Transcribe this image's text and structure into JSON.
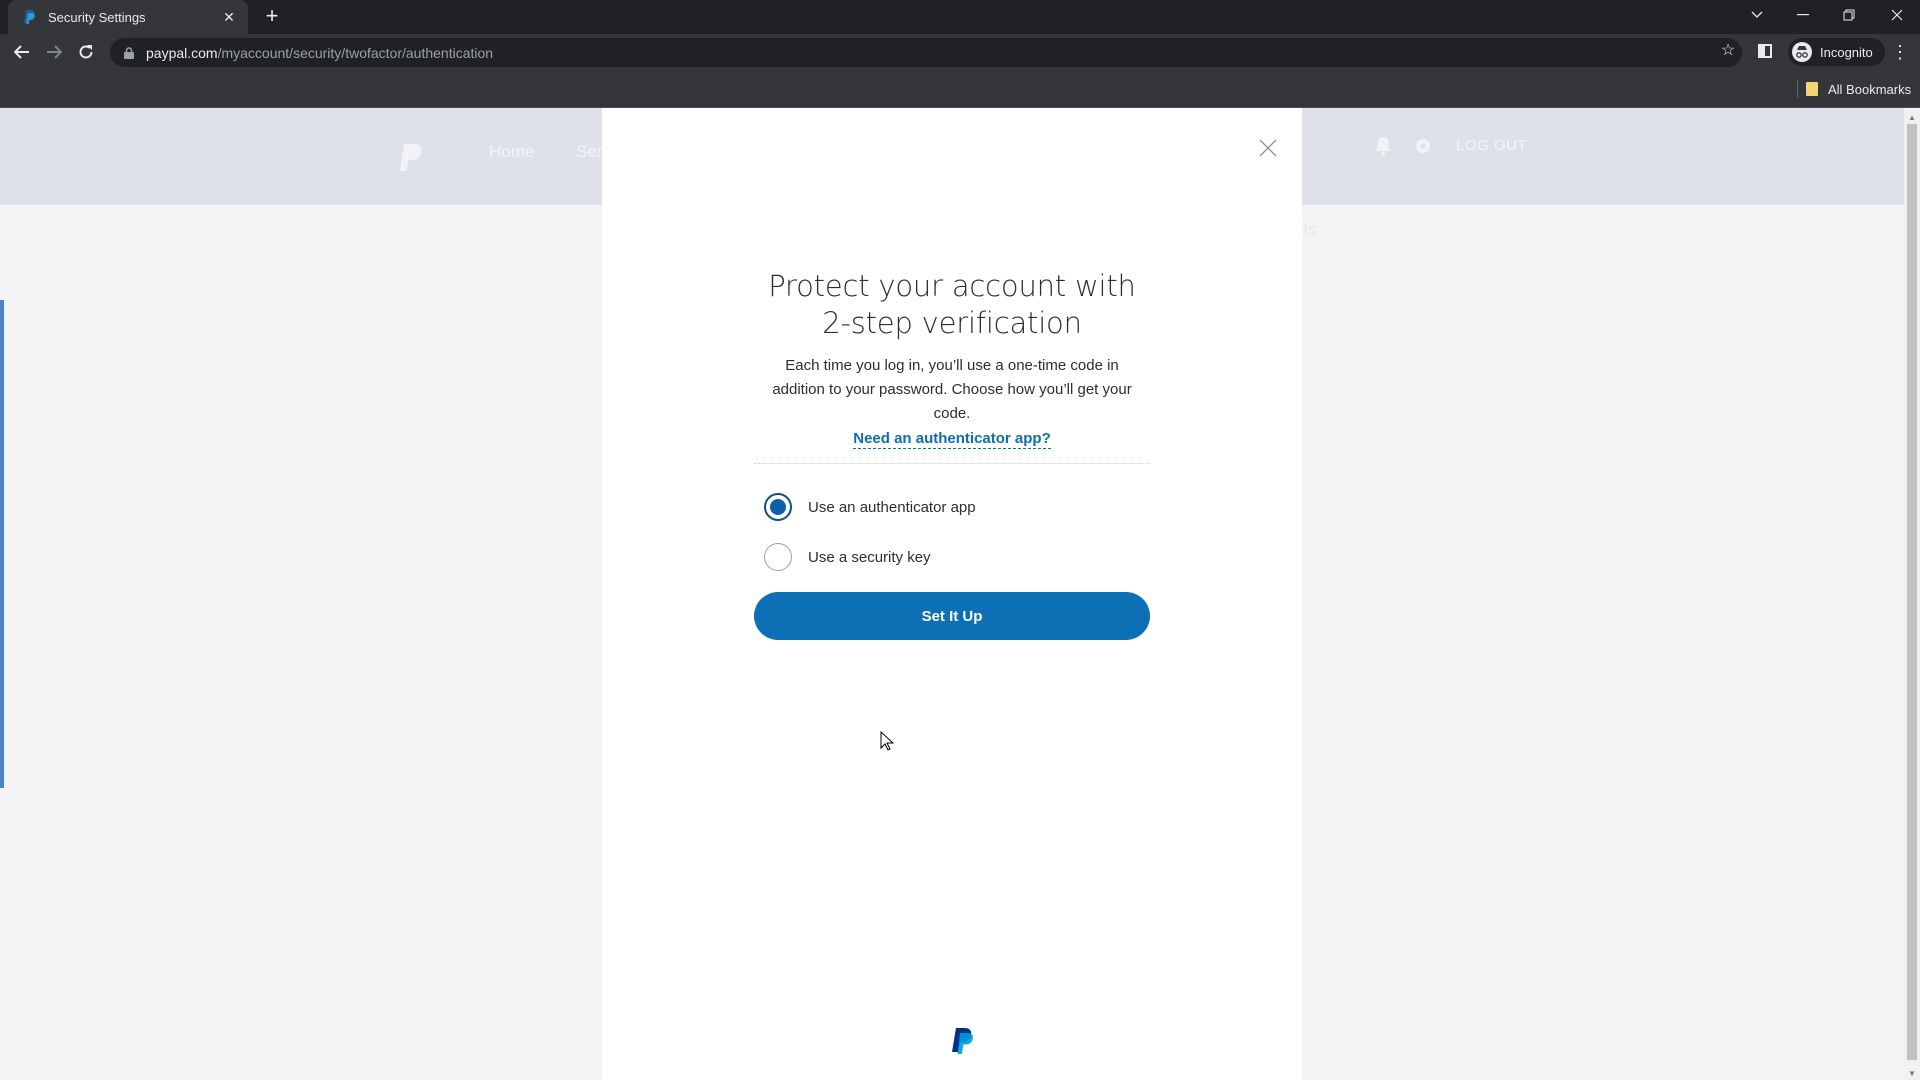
{
  "browser": {
    "tab": {
      "title": "Security Settings",
      "favicon": "paypal-favicon",
      "close_icon": "close-icon"
    },
    "new_tab_icon": "plus-icon",
    "window_controls": [
      "chevron-down-icon",
      "minimize-icon",
      "restore-icon",
      "close-icon"
    ],
    "url": {
      "host": "paypal.com",
      "path": "/myaccount/security/twofactor/authentication"
    },
    "profile_label": "Incognito",
    "bookmarks_label": "All Bookmarks"
  },
  "page": {
    "nav": [
      "Home",
      "Ser"
    ],
    "logout_label": "LOG OUT",
    "background_fragment": "ils"
  },
  "modal": {
    "title": "Protect your account with 2-step verification",
    "body": "Each time you log in, you’ll use a one-time code in addition to your password. Choose how you’ll get your code.",
    "help_link": "Need an authenticator app?",
    "options": [
      {
        "label": "Use an authenticator app",
        "selected": true
      },
      {
        "label": "Use a security key",
        "selected": false
      }
    ],
    "cta_label": "Set It Up"
  },
  "colors": {
    "brand_blue": "#0e70b4",
    "link_blue": "#0e6fa8",
    "radio_selected": "#0e5fa5",
    "paypal_dark": "#003087",
    "paypal_light": "#009cde"
  }
}
